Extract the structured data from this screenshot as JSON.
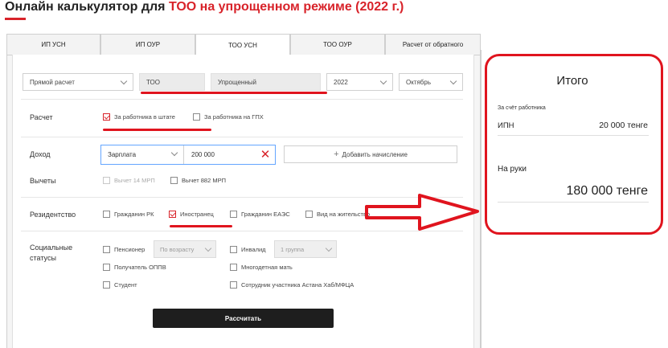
{
  "title": {
    "prefix": "Онлайн калькулятор для ",
    "highlight": "ТОО на упрощенном режиме (2022 г.)"
  },
  "tabs": [
    {
      "label": "ИП УСН",
      "active": false
    },
    {
      "label": "ИП ОУР",
      "active": false
    },
    {
      "label": "ТОО УСН",
      "active": true
    },
    {
      "label": "ТОО ОУР",
      "active": false
    },
    {
      "label": "Расчет от обратного",
      "active": false
    }
  ],
  "settings": {
    "mode": "Прямой расчет",
    "entity": "ТОО",
    "regime": "Упрощенный",
    "year": "2022",
    "month": "Октябрь"
  },
  "calc": {
    "label": "Расчет",
    "options": [
      {
        "label": "За работника в штате",
        "checked": true
      },
      {
        "label": "За работника на ГПХ",
        "checked": false
      }
    ]
  },
  "income": {
    "label": "Доход",
    "type": "Зарплата",
    "amount": "200 000",
    "add_label": "Добавить начисление"
  },
  "deductions": {
    "label": "Вычеты",
    "options": [
      {
        "label": "Вычет 14 МРП",
        "checked": false,
        "disabled": true
      },
      {
        "label": "Вычет 882 МРП",
        "checked": false,
        "disabled": false
      }
    ]
  },
  "residency": {
    "label": "Резидентство",
    "options": [
      {
        "label": "Гражданин РК",
        "checked": false
      },
      {
        "label": "Иностранец",
        "checked": true
      },
      {
        "label": "Гражданин ЕАЭС",
        "checked": false
      },
      {
        "label": "Вид на жительство",
        "checked": false
      }
    ]
  },
  "social": {
    "label_line1": "Социальные",
    "label_line2": "статусы",
    "pensioner": "Пенсионер",
    "pensioner_select": "По возрасту",
    "invalid": "Инвалид",
    "invalid_select": "1 группа",
    "oppv": "Получатель ОППВ",
    "mother": "Многодетная мать",
    "student": "Студент",
    "astana": "Сотрудник участника Астана Хаб/МФЦА"
  },
  "calculate_label": "Рассчитать",
  "result": {
    "title": "Итого",
    "employee_label": "За счёт работника",
    "ipn_label": "ИПН",
    "ipn_value": "20 000 тенге",
    "net_label": "На руки",
    "net_value": "180 000 тенге"
  },
  "colors": {
    "accent": "#d8232a",
    "annotation": "#e0141e",
    "button": "#1e1e1e"
  }
}
